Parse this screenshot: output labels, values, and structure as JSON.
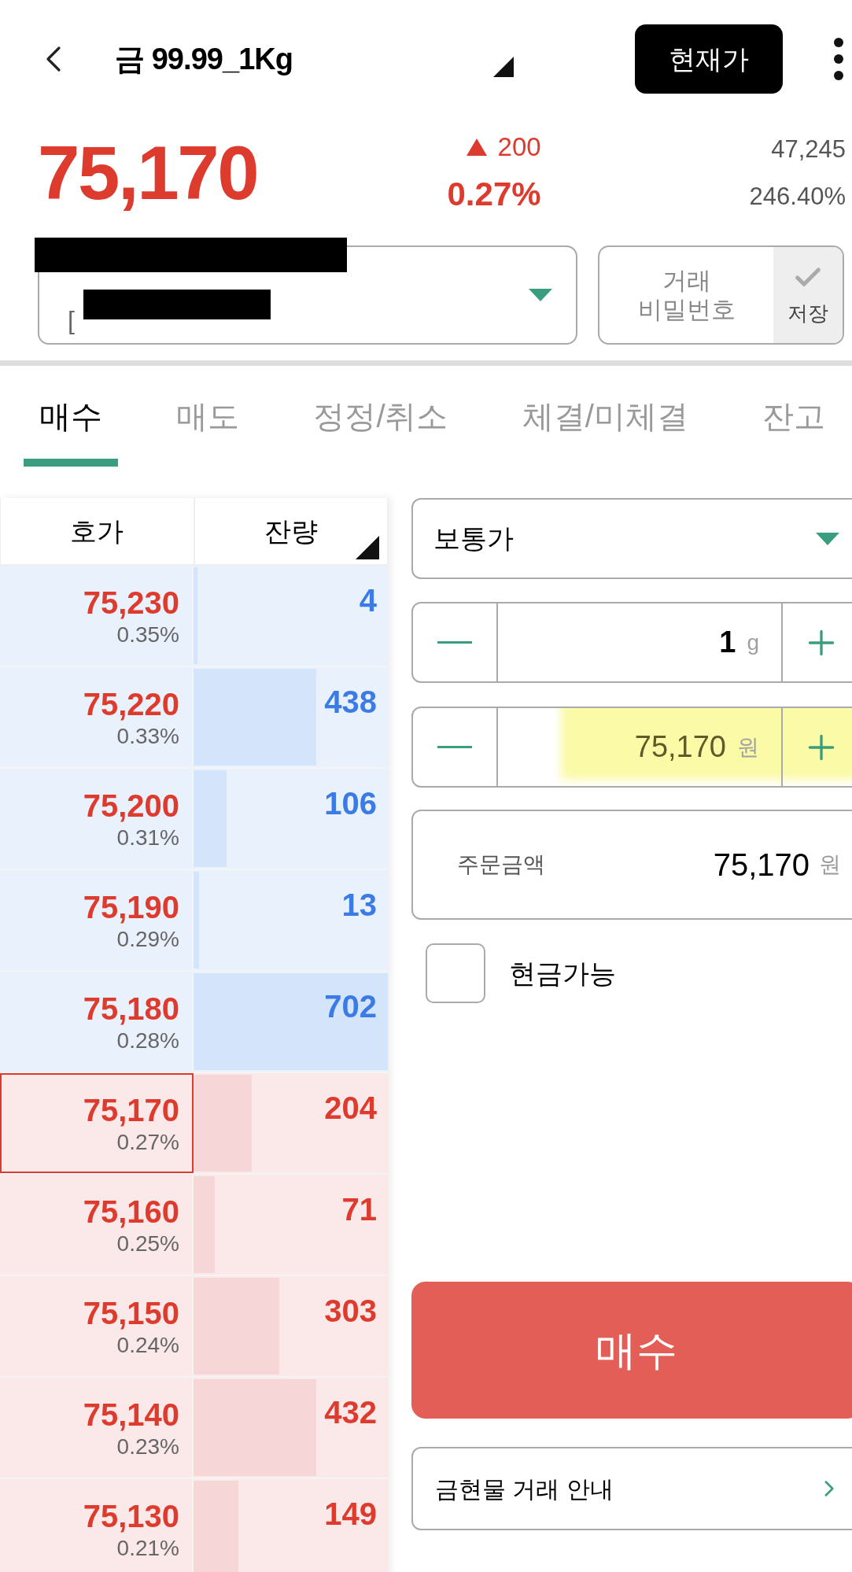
{
  "header": {
    "title": "금 99.99_1Kg",
    "current_price_button": "현재가"
  },
  "quote": {
    "price": "75,170",
    "change": "200",
    "change_rate": "0.27%",
    "volume": "47,245",
    "volume_rate": "246.40%"
  },
  "account": {
    "prefix": "[",
    "password_label": "거래\n비밀번호",
    "save_label": "저장",
    "save_checked": false
  },
  "tabs": [
    {
      "label": "매수",
      "selected": true
    },
    {
      "label": "매도",
      "selected": false
    },
    {
      "label": "정정/취소",
      "selected": false
    },
    {
      "label": "체결/미체결",
      "selected": false
    },
    {
      "label": "잔고",
      "selected": false
    }
  ],
  "orderbook": {
    "columns": [
      "호가",
      "잔량"
    ],
    "rows": [
      {
        "price": "75,230",
        "rate": "0.35%",
        "qty": "4",
        "kind": "ask",
        "level": 0.02,
        "selected": false
      },
      {
        "price": "75,220",
        "rate": "0.33%",
        "qty": "438",
        "kind": "ask",
        "level": 0.63,
        "selected": false
      },
      {
        "price": "75,200",
        "rate": "0.31%",
        "qty": "106",
        "kind": "ask",
        "level": 0.17,
        "selected": false
      },
      {
        "price": "75,190",
        "rate": "0.29%",
        "qty": "13",
        "kind": "ask",
        "level": 0.03,
        "selected": false
      },
      {
        "price": "75,180",
        "rate": "0.28%",
        "qty": "702",
        "kind": "ask",
        "level": 1,
        "selected": false
      },
      {
        "price": "75,170",
        "rate": "0.27%",
        "qty": "204",
        "kind": "bid",
        "level": 0.3,
        "selected": true
      },
      {
        "price": "75,160",
        "rate": "0.25%",
        "qty": "71",
        "kind": "bid",
        "level": 0.11,
        "selected": false
      },
      {
        "price": "75,150",
        "rate": "0.24%",
        "qty": "303",
        "kind": "bid",
        "level": 0.44,
        "selected": false
      },
      {
        "price": "75,140",
        "rate": "0.23%",
        "qty": "432",
        "kind": "bid",
        "level": 0.63,
        "selected": false
      },
      {
        "price": "75,130",
        "rate": "0.21%",
        "qty": "149",
        "kind": "bid",
        "level": 0.23,
        "selected": false
      }
    ]
  },
  "order": {
    "order_type": "보통가",
    "quantity": {
      "value": "1",
      "unit": "g"
    },
    "price": {
      "value": "75,170",
      "unit": "원",
      "highlighted": true
    },
    "amount": {
      "label": "주문금액",
      "value": "75,170",
      "unit": "원"
    },
    "cash_only": {
      "label": "현금가능",
      "checked": false
    },
    "submit": "매수",
    "guide": "금현물 거래 안내"
  }
}
